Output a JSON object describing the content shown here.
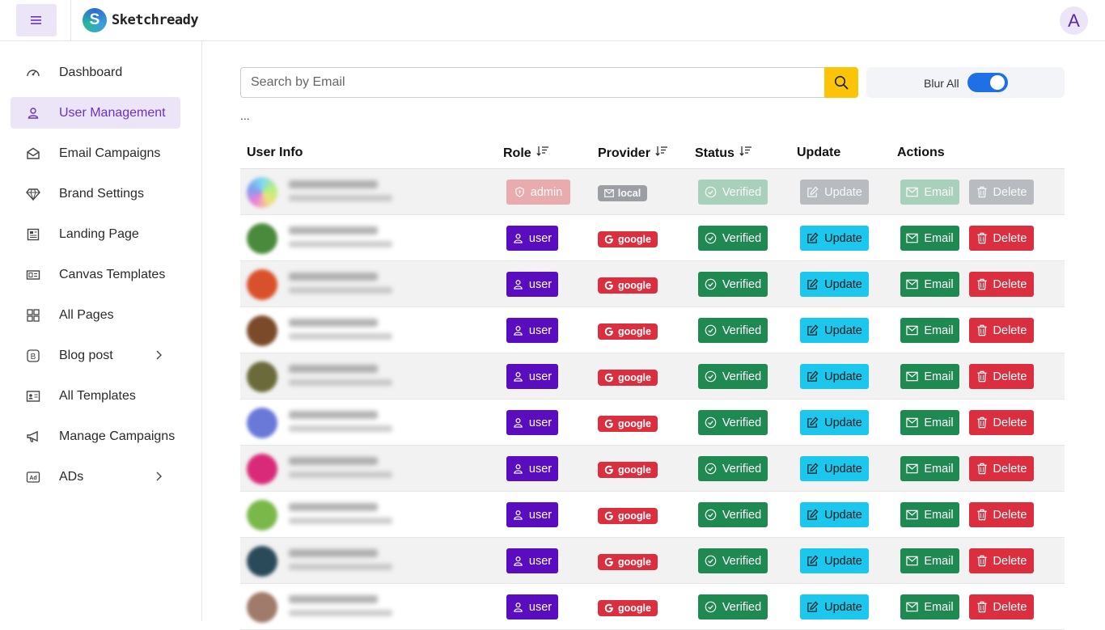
{
  "app": {
    "brand": "Sketchready",
    "logo_letter": "S",
    "avatar_letter": "A",
    "accent_color": "#5a0cbf",
    "active_nav_bg": "#ece4f7"
  },
  "sidebar": {
    "items": [
      {
        "label": "Dashboard",
        "icon": "gauge-icon"
      },
      {
        "label": "User Management",
        "icon": "user-icon",
        "active": true
      },
      {
        "label": "Email Campaigns",
        "icon": "envelope-open-icon"
      },
      {
        "label": "Brand Settings",
        "icon": "gem-icon"
      },
      {
        "label": "Landing Page",
        "icon": "newspaper-icon"
      },
      {
        "label": "Canvas Templates",
        "icon": "card-layout-icon"
      },
      {
        "label": "All Pages",
        "icon": "grid-icon"
      },
      {
        "label": "Blog post",
        "icon": "b-square-icon",
        "has_submenu": true
      },
      {
        "label": "All Templates",
        "icon": "id-card-icon"
      },
      {
        "label": "Manage Campaigns",
        "icon": "megaphone-icon"
      },
      {
        "label": "ADs",
        "icon": "ad-icon",
        "has_submenu": true
      }
    ]
  },
  "search": {
    "placeholder": "Search by Email",
    "value": ""
  },
  "blur_toggle": {
    "label": "Blur All",
    "on": true
  },
  "ellipsis": "...",
  "table": {
    "headers": {
      "user_info": "User Info",
      "role": "Role",
      "provider": "Provider",
      "status": "Status",
      "update": "Update",
      "actions": "Actions"
    },
    "action_labels": {
      "update": "Update",
      "email": "Email",
      "delete": "Delete"
    },
    "rows": [
      {
        "role": "admin",
        "provider": "local",
        "status": "Verified",
        "avatar_color": "#7fd8f0",
        "disabled": true
      },
      {
        "role": "user",
        "provider": "google",
        "status": "Verified",
        "avatar_color": "#4a8a3c"
      },
      {
        "role": "user",
        "provider": "google",
        "status": "Verified",
        "avatar_color": "#d9512a"
      },
      {
        "role": "user",
        "provider": "google",
        "status": "Verified",
        "avatar_color": "#7a4a2a"
      },
      {
        "role": "user",
        "provider": "google",
        "status": "Verified",
        "avatar_color": "#6a6a3a"
      },
      {
        "role": "user",
        "provider": "google",
        "status": "Verified",
        "avatar_color": "#6a78d8"
      },
      {
        "role": "user",
        "provider": "google",
        "status": "Verified",
        "avatar_color": "#d82a78"
      },
      {
        "role": "user",
        "provider": "google",
        "status": "Verified",
        "avatar_color": "#7ab84a"
      },
      {
        "role": "user",
        "provider": "google",
        "status": "Verified",
        "avatar_color": "#2a4a5a"
      },
      {
        "role": "user",
        "provider": "google",
        "status": "Verified",
        "avatar_color": "#a07a6a"
      }
    ]
  }
}
